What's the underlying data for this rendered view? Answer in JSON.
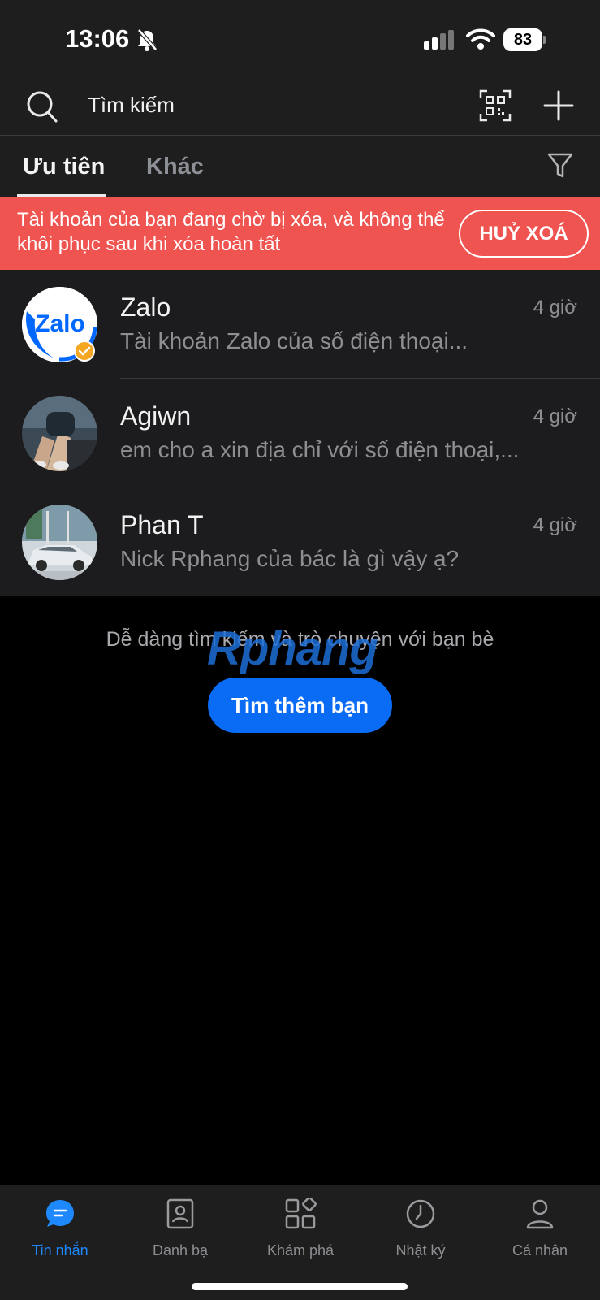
{
  "status_bar": {
    "time": "13:06",
    "battery": "83"
  },
  "search": {
    "placeholder": "Tìm kiếm"
  },
  "tabs": [
    {
      "label": "Ưu tiên"
    },
    {
      "label": "Khác"
    }
  ],
  "banner": {
    "text": "Tài khoản của bạn đang chờ bị xóa, và không thể khôi phục sau khi xóa hoàn tất",
    "button": "HUỶ XOÁ"
  },
  "chats": [
    {
      "name": "Zalo",
      "time": "4 giờ",
      "preview": "Tài khoản Zalo của số điện thoại..."
    },
    {
      "name": "Agiwn",
      "time": "4 giờ",
      "preview": "em cho a xin địa chỉ với số điện thoại,..."
    },
    {
      "name": "Phan T",
      "time": "4 giờ",
      "preview": "Nick Rphang của bác là gì vậy ạ?"
    }
  ],
  "zalo_logo_text": "Zalo",
  "empty_state": {
    "hint": "Dễ dàng tìm kiếm và trò chuyện với bạn bè",
    "button": "Tìm thêm bạn"
  },
  "watermark": "Rphang",
  "bottom_nav": [
    {
      "label": "Tin nhắn",
      "icon": "chat-icon"
    },
    {
      "label": "Danh bạ",
      "icon": "contacts-icon"
    },
    {
      "label": "Khám phá",
      "icon": "discover-icon"
    },
    {
      "label": "Nhật ký",
      "icon": "clock-icon"
    },
    {
      "label": "Cá nhân",
      "icon": "profile-icon"
    }
  ],
  "colors": {
    "accent": "#0A6CF5",
    "banner": "#EF5451",
    "background": "#000000",
    "surface": "#1E1E1E"
  }
}
